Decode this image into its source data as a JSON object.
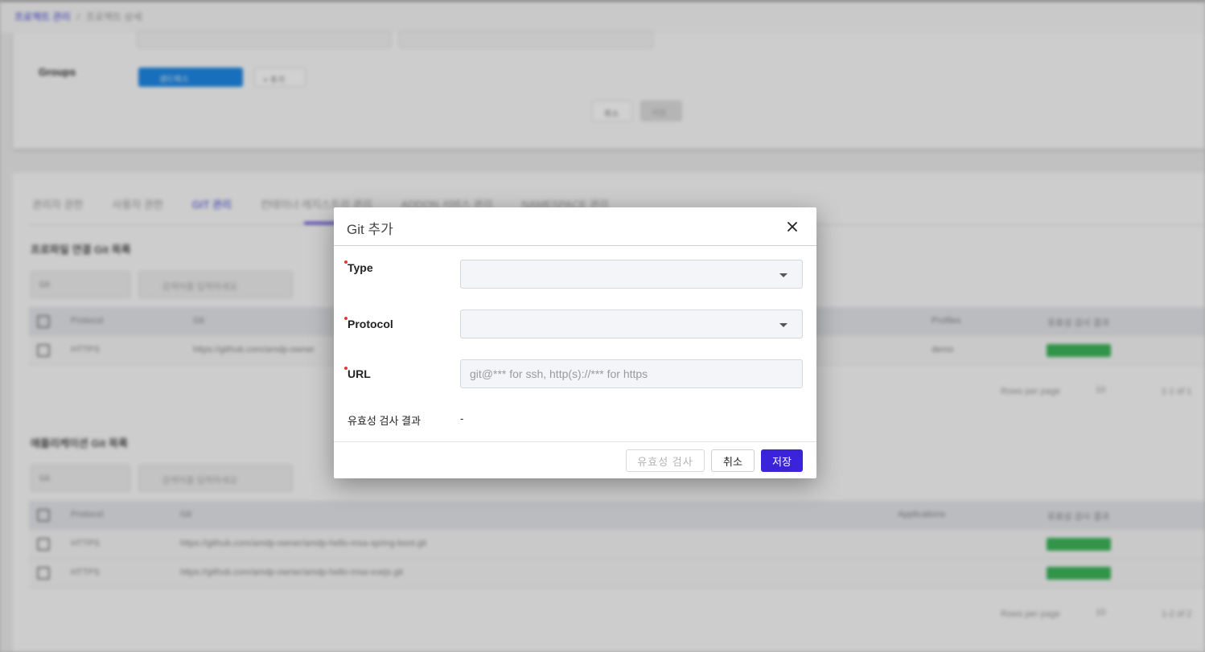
{
  "background": {
    "breadcrumb": {
      "link": "프로젝트 관리",
      "separator": "/",
      "current": "프로젝트 상세"
    },
    "groups_label": "Groups",
    "groups_chip": "샌드박스",
    "groups_add": "+ 추가",
    "form_cancel": "취소",
    "form_save": "저장",
    "tabs": [
      "관리자 권한",
      "사용자 권한",
      "GIT 관리",
      "컨테이너 레지스트리 관리",
      "ADDON 서비스 관리",
      "NAMESPACE 관리"
    ],
    "section1_title": "프로파일 연결 Git 목록",
    "section2_title": "애플리케이션 Git 목록",
    "select_value": "Git",
    "search_placeholder": "검색어를 입력하세요",
    "table1": {
      "headers": [
        "Protocol",
        "Git",
        "Profiles",
        "유효성 검사 결과"
      ],
      "rows": [
        {
          "protocol": "HTTPS",
          "git": "https://github.com/amdp-owner",
          "profile": "demo"
        }
      ]
    },
    "table2": {
      "headers": [
        "Protocol",
        "Git",
        "Applications",
        "유효성 검사 결과"
      ],
      "rows": [
        {
          "protocol": "HTTPS",
          "git": "https://github.com/amdp-owner/amdp-hello-msa-spring-boot.git"
        },
        {
          "protocol": "HTTPS",
          "git": "https://github.com/amdp-owner/amdp-hello-msa-vuejs.git"
        }
      ]
    },
    "rows_per_page_label": "Rows per page",
    "rows_per_page_value": "10",
    "pager1": "1-1 of 1",
    "pager2": "1-2 of 2"
  },
  "dialog": {
    "title": "Git 추가",
    "close_icon": "close-icon",
    "fields": {
      "type_label": "Type",
      "type_value": "",
      "protocol_label": "Protocol",
      "protocol_value": "",
      "url_label": "URL",
      "url_value": "",
      "url_placeholder": "git@*** for ssh, http(s)://*** for https"
    },
    "validation_label": "유효성 검사 결과",
    "validation_value": "-",
    "buttons": {
      "validate": "유효성 검사",
      "cancel": "취소",
      "save": "저장"
    },
    "colors": {
      "primary": "#3a23d8",
      "required_mark": "#e53935",
      "success": "#3cb55a"
    }
  }
}
